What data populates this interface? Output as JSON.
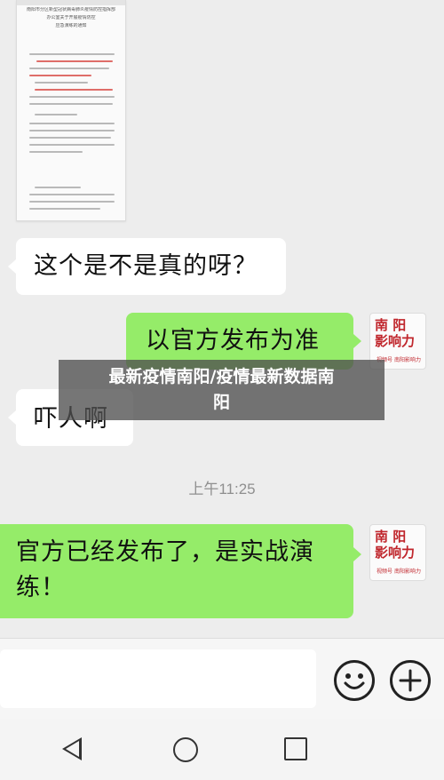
{
  "document_image": {
    "title_lines": [
      "南阳市分区新型冠状病毒肺炎疫情防控指挥部",
      "办公室关于开展疫情防控",
      "应急演练的通知"
    ]
  },
  "messages": [
    {
      "id": "m1",
      "side": "left",
      "text": "这个是不是真的呀？"
    },
    {
      "id": "m2",
      "side": "right",
      "text": "以官方发布为准"
    },
    {
      "id": "m3",
      "side": "left",
      "text": "吓人啊"
    },
    {
      "id": "m4",
      "side": "right",
      "text_line1": "官方已经发布了，是实战演",
      "text_line2": "练！"
    }
  ],
  "timestamp": "上午11:25",
  "overlay_title_line1": "最新疫情南阳/疫情最新数据南",
  "overlay_title_line2": "阳",
  "avatar": {
    "seal_line1": "南  阳",
    "seal_line2": "影响力",
    "caption": "视频号 南阳影响力"
  },
  "icons": {
    "emoji": "smiley-icon",
    "plus": "plus-icon",
    "back": "triangle-back-icon",
    "home": "circle-home-icon",
    "recent": "square-recent-icon"
  }
}
